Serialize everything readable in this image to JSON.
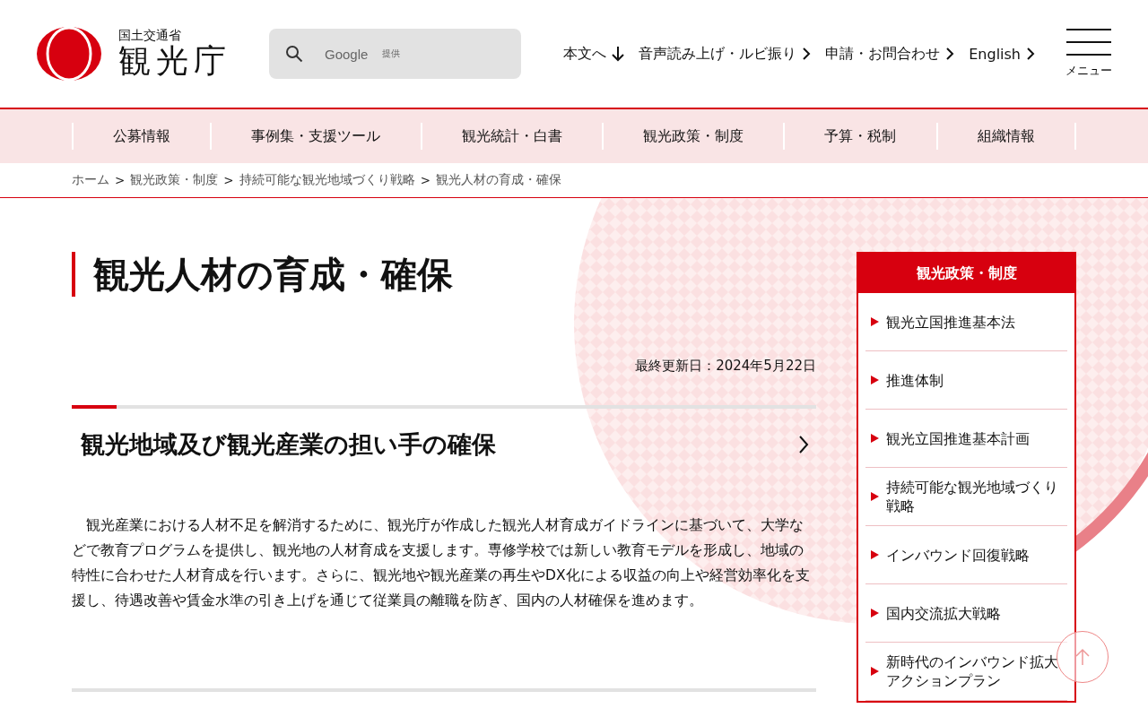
{
  "header": {
    "ministry": "国土交通省",
    "agency": "観光庁",
    "search": {
      "placeholder": "Google",
      "provider": "提供"
    },
    "utility_links": [
      {
        "label": "本文へ",
        "kind": "jump"
      },
      {
        "label": "音声読み上げ・ルビ振り",
        "kind": "link"
      },
      {
        "label": "申請・お問合わせ",
        "kind": "link"
      },
      {
        "label": "English",
        "kind": "link"
      }
    ],
    "menu_label": "メニュー"
  },
  "global_nav": [
    "公募情報",
    "事例集・支援ツール",
    "観光統計・白書",
    "観光政策・制度",
    "予算・税制",
    "組織情報"
  ],
  "breadcrumb": [
    {
      "label": "ホーム"
    },
    {
      "separator": ">",
      "label": "観光政策・制度"
    },
    {
      "separator": ">",
      "label": "持続可能な観光地域づくり戦略"
    },
    {
      "separator": ">",
      "label": "観光人材の育成・確保"
    }
  ],
  "page": {
    "title": "観光人材の育成・確保",
    "updated": "最終更新日：2024年5月22日",
    "sections": [
      {
        "heading": "観光地域及び観光産業の担い手の確保",
        "body": "　観光産業における人材不足を解消するために、観光庁が作成した観光人材育成ガイドラインに基づいて、大学などで教育プログラムを提供し、観光地の人材育成を支援します。専修学校では新しい教育モデルを形成し、地域の特性に合わせた人材育成を行います。さらに、観光地や観光産業の再生やDX化による収益の向上や経営効率化を支援し、待遇改善や賃金水準の引き上げを通じて従業員の離職を防ぎ、国内の人材確保を進めます。"
      }
    ]
  },
  "sidebar": {
    "title": "観光政策・制度",
    "items": [
      "観光立国推進基本法",
      "推進体制",
      "観光立国推進基本計画",
      "持続可能な観光地域づくり戦略",
      "インバウンド回復戦略",
      "国内交流拡大戦略",
      "新時代のインバウンド拡大アクションプラン"
    ]
  }
}
